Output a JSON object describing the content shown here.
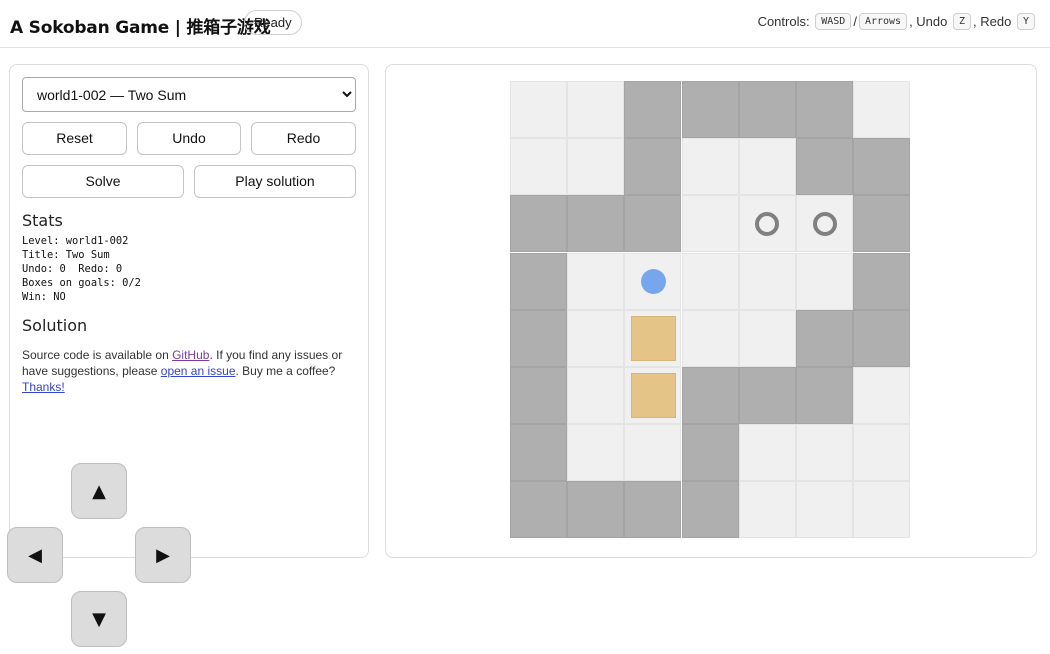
{
  "header": {
    "title": "A Sokoban Game | 推箱子游戏",
    "status": "Ready",
    "controls": {
      "label": "Controls:",
      "move_keys": [
        "WASD",
        "Arrows"
      ],
      "separator": "/",
      "undo_label": ", Undo",
      "undo_key": "Z",
      "redo_label": ", Redo",
      "redo_key": "Y"
    }
  },
  "sidebar": {
    "level_select": {
      "selected": "world1-002 — Two Sum"
    },
    "buttons": {
      "reset": "Reset",
      "undo": "Undo",
      "redo": "Redo",
      "solve": "Solve",
      "play_solution": "Play solution"
    },
    "stats": {
      "heading": "Stats",
      "lines": [
        "Level: world1-002",
        "Title: Two Sum",
        "Undo: 0  Redo: 0",
        "Boxes on goals: 0/2",
        "Win: NO"
      ]
    },
    "solution": {
      "heading": "Solution"
    },
    "about": {
      "text1": "Source code is available on ",
      "github_link": "GitHub",
      "text2": ". If you find any issues or have suggestions, please ",
      "issue_link": "open an issue",
      "text3": ". Buy me a coffee? ",
      "thanks_link": "Thanks!"
    }
  },
  "dpad": {
    "up": "▲",
    "left": "◀",
    "right": "▶",
    "down": "▼"
  },
  "board": {
    "map": [
      "  ###  ",
      "  #  ##",
      "###  ..",
      "#      ",
      "# $  ##",
      "# $### ",
      "#  #   ",
      "####   "
    ],
    "walls_map": [
      "..####.",
      "..#..##",
      "###...#",
      "#.....#",
      "#....##",
      "#..###.",
      "#..#...",
      "####..."
    ],
    "player": {
      "row": 3,
      "col": 2
    },
    "boxes": [
      {
        "row": 4,
        "col": 2
      },
      {
        "row": 5,
        "col": 2
      }
    ],
    "goals": [
      {
        "row": 2,
        "col": 4
      },
      {
        "row": 2,
        "col": 5
      }
    ],
    "colors": {
      "wall": "#afafaf",
      "floor": "#f0f0f0",
      "box": "#e4c487",
      "goal": "#808080",
      "player": "#76a7ec"
    }
  }
}
